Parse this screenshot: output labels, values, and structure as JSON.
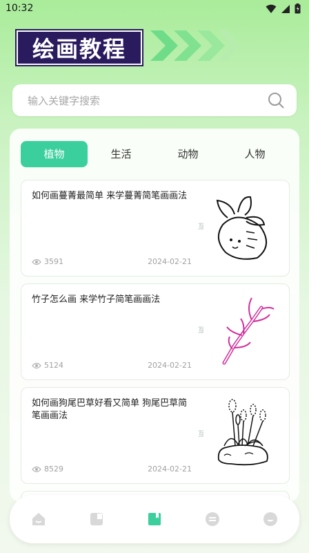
{
  "status": {
    "time": "10:32"
  },
  "header": {
    "title": "绘画教程"
  },
  "search": {
    "placeholder": "输入关键字搜索",
    "value": ""
  },
  "tabs": [
    {
      "label": "植物",
      "active": true
    },
    {
      "label": "生活",
      "active": false
    },
    {
      "label": "动物",
      "active": false
    },
    {
      "label": "人物",
      "active": false
    }
  ],
  "cards": [
    {
      "title": "如何画蔓菁最简单 来学蔓菁简笔画画法",
      "views": "3591",
      "date": "2024-02-21",
      "watermark": "互周"
    },
    {
      "title": "竹子怎么画 来学竹子简笔画画法",
      "views": "5124",
      "date": "2024-02-21",
      "watermark": "互周"
    },
    {
      "title": "如何画狗尾巴草好看又简单 狗尾巴草简笔画画法",
      "views": "8529",
      "date": "2024-02-21",
      "watermark": "互周"
    }
  ],
  "bottom_nav": [
    "home-icon",
    "grid-icon",
    "book-icon",
    "menu-icon",
    "smile-icon"
  ],
  "colors": {
    "accent": "#3bcf9e",
    "title_bg": "#2a1a5e",
    "chevron": "#7ce08a"
  }
}
